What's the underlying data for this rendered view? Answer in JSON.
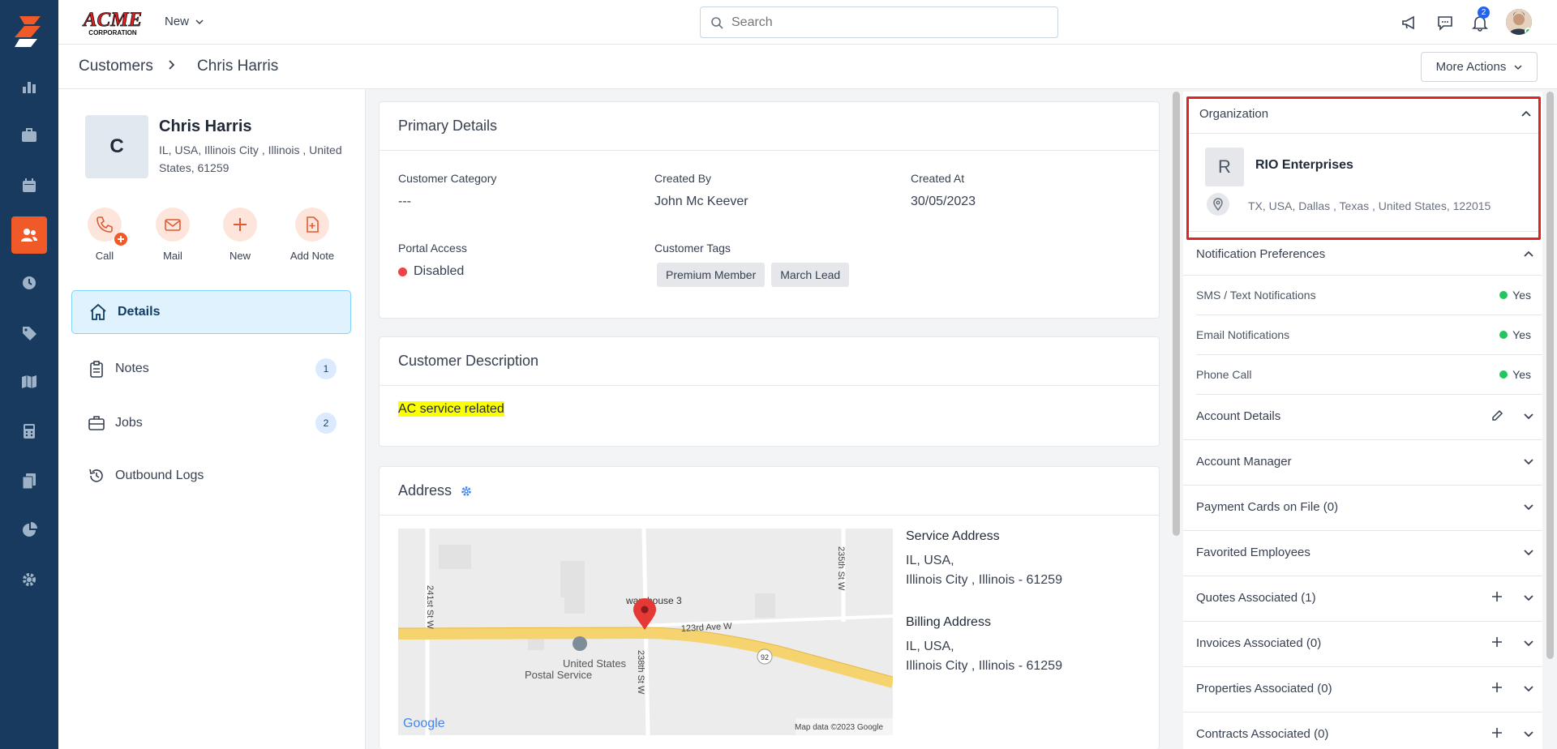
{
  "topbar": {
    "brand": "ACME CORPORATION",
    "new_label": "New",
    "search_placeholder": "Search",
    "notification_count": "2"
  },
  "breadcrumb": {
    "parent": "Customers",
    "current": "Chris Harris",
    "more_actions": "More Actions"
  },
  "customer": {
    "initial": "C",
    "name": "Chris Harris",
    "address": "IL, USA, Illinois City , Illinois , United States, 61259"
  },
  "quick_actions": [
    {
      "label": "Call"
    },
    {
      "label": "Mail"
    },
    {
      "label": "New"
    },
    {
      "label": "Add Note"
    }
  ],
  "side_nav": [
    {
      "label": "Details",
      "count": ""
    },
    {
      "label": "Notes",
      "count": "1"
    },
    {
      "label": "Jobs",
      "count": "2"
    },
    {
      "label": "Outbound Logs",
      "count": ""
    }
  ],
  "primary_details": {
    "title": "Primary Details",
    "customer_category_label": "Customer Category",
    "customer_category_value": "---",
    "created_by_label": "Created By",
    "created_by_value": "John Mc Keever",
    "created_at_label": "Created At",
    "created_at_value": "30/05/2023",
    "portal_access_label": "Portal Access",
    "portal_access_value": "Disabled",
    "customer_tags_label": "Customer Tags",
    "tags": [
      "Premium Member",
      "March Lead"
    ]
  },
  "description": {
    "title": "Customer Description",
    "text": "AC service related"
  },
  "address": {
    "title": "Address",
    "service_title": "Service Address",
    "service_line1": "IL, USA,",
    "service_line2": "Illinois City , Illinois - 61259",
    "billing_title": "Billing Address",
    "billing_line1": "IL, USA,",
    "billing_line2": "Illinois City , Illinois - 61259",
    "map": {
      "labels": {
        "street_241": "241st St W",
        "street_235": "235th St W",
        "street_238": "238th St W",
        "street_123": "123rd Ave W",
        "marker": "warehouse 3",
        "poi_line1": "United States",
        "poi_line2": "Postal Service",
        "route": "92",
        "google": "Google",
        "attribution": "Map data ©2023 Google"
      }
    }
  },
  "organization": {
    "header": "Organization",
    "initial": "R",
    "name": "RIO Enterprises",
    "address": "TX, USA, Dallas , Texas , United States, 122015"
  },
  "notification_prefs": {
    "header": "Notification Preferences",
    "items": [
      {
        "label": "SMS / Text Notifications",
        "value": "Yes"
      },
      {
        "label": "Email Notifications",
        "value": "Yes"
      },
      {
        "label": "Phone Call",
        "value": "Yes"
      }
    ]
  },
  "right_sections": [
    {
      "label": "Account Details"
    },
    {
      "label": "Account Manager"
    },
    {
      "label": "Payment Cards on File (0)"
    },
    {
      "label": "Favorited Employees"
    },
    {
      "label": "Quotes Associated (1)"
    },
    {
      "label": "Invoices Associated (0)"
    },
    {
      "label": "Properties Associated (0)"
    },
    {
      "label": "Contracts Associated (0)"
    }
  ],
  "colors": {
    "rail": "#173a5e",
    "accent": "#f05a28",
    "highlight": "#e02424",
    "status_disabled": "#ef4444",
    "status_yes": "#22c55e"
  }
}
